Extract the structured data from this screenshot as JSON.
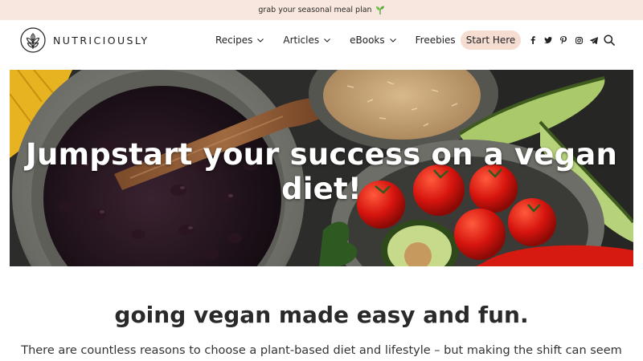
{
  "announcement": {
    "text": "grab your seasonal meal plan",
    "icon": "sprout-icon"
  },
  "brand": {
    "name": "NUTRICIOUSLY",
    "logo_icon": "leaf-circle-icon"
  },
  "nav": {
    "items": [
      {
        "label": "Recipes"
      },
      {
        "label": "Articles"
      },
      {
        "label": "eBooks"
      },
      {
        "label": "Freebies"
      }
    ],
    "cta_label": "Start Here",
    "social_icons": [
      "facebook-icon",
      "twitter-icon",
      "pinterest-icon",
      "instagram-icon",
      "telegram-icon"
    ],
    "search_icon": "search-icon"
  },
  "hero": {
    "title": "Jumpstart your success on a vegan diet!"
  },
  "content": {
    "tagline": "going vegan made easy and fun.",
    "intro": "There are countless reasons to choose a plant-based diet and lifestyle – but making the shift can seem"
  },
  "colors": {
    "topbar_bg": "#f8e7df",
    "cta_bg": "#f6ddd2",
    "text": "#222222"
  }
}
